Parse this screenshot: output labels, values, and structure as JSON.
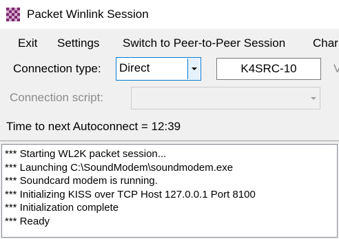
{
  "window": {
    "title": "Packet Winlink Session",
    "icon": "checkered-app-icon"
  },
  "menu": {
    "items": [
      "Exit",
      "Settings",
      "Switch to Peer-to-Peer Session",
      "Char"
    ]
  },
  "connection": {
    "type_label": "Connection type:",
    "type_value": "Direct",
    "callsign": "K4SRC-10",
    "cut_label": "V",
    "script_label": "Connection script:",
    "script_value": ""
  },
  "status": {
    "autoconnect_text": "Time to next Autoconnect = 12:39"
  },
  "log": {
    "lines": [
      "*** Starting WL2K packet session...",
      "*** Launching C:\\SoundModem\\soundmodem.exe",
      "*** Soundcard modem is running.",
      "*** Initializing KISS over TCP Host 127.0.0.1 Port 8100",
      "*** Initialization complete",
      "*** Ready"
    ]
  },
  "colors": {
    "focus_border": "#0078d7",
    "disabled_text": "#8c8c8c",
    "icon_dark": "#7a2a6e",
    "icon_light": "#d9a8d0"
  }
}
